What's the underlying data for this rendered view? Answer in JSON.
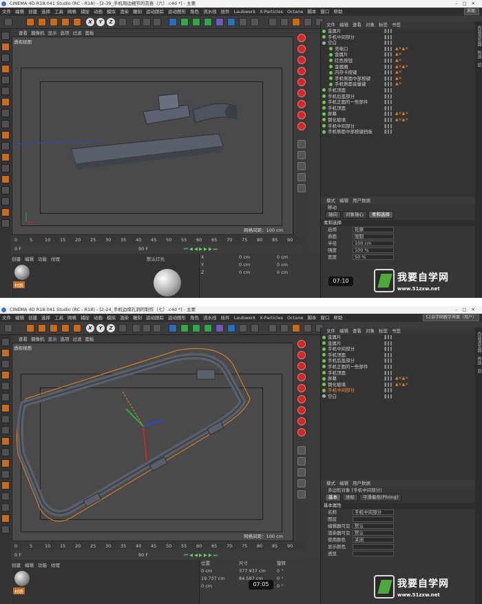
{
  "s1": {
    "title": "CINEMA 4D R18.041 Studio (RC - R18) - [2-39_手机周边细节的完善（六）.c4d *] - 主要",
    "menu": [
      "文件",
      "编辑",
      "创建",
      "选择",
      "工具",
      "网格",
      "捕捉",
      "动画",
      "模拟",
      "渲染",
      "雕刻",
      "运动跟踪",
      "运动图形",
      "角色",
      "流水线",
      "插件",
      "Laubwerk",
      "X-Particles",
      "Octane",
      "脚本",
      "窗口",
      "帮助"
    ],
    "layout": "界面:",
    "vpmenu": [
      "查看",
      "摄像机",
      "显示",
      "选项",
      "过滤",
      "面板"
    ],
    "vptitle": "透视视图",
    "grid": "网格间距：100 cm",
    "objmenu": [
      "文件",
      "编辑",
      "查看",
      "对象",
      "标签",
      "书签"
    ],
    "objects": [
      "金属片",
      "手机中间部分",
      "空白",
      "充电口",
      "金属片",
      "红色按钮",
      "金属圈",
      "内存卡按键",
      "手机侧面中部按键",
      "手机侧面音量键",
      "手机顶面",
      "手机后盖部分",
      "手机正面的一些部件",
      "手机顶面",
      "屏幕",
      "钢化玻璃",
      "手机中间部分",
      "手机侧面中部按键挡板"
    ],
    "attrmenu": [
      "模式",
      "编辑",
      "用户数据"
    ],
    "attrobj": "移动",
    "tabs": [
      "轴向",
      "对象轴心",
      "柔和选择"
    ],
    "sec": "柔和选择",
    "props": [
      [
        "启用",
        "轮廓"
      ],
      [
        "表面",
        "限制"
      ],
      [
        "半径",
        "100 cm"
      ],
      [
        "强度",
        "100 %"
      ],
      [
        "宽度",
        "50 %"
      ]
    ],
    "ticks": [
      "0",
      "5",
      "10",
      "15",
      "20",
      "25",
      "30",
      "35",
      "40",
      "45",
      "50",
      "55",
      "60",
      "65",
      "70",
      "75",
      "80",
      "85",
      "90"
    ],
    "frame": "0 F",
    "endframe": "90 F",
    "matmenu": [
      "创建",
      "编辑",
      "功能",
      "纹理"
    ],
    "matlabel": "材质",
    "light": "默认灯光",
    "coords": [
      [
        "X",
        "0 cm",
        "X",
        "0 cm",
        "H",
        "0 °"
      ],
      [
        "Y",
        "0 cm",
        "Y",
        "0 cm",
        "P",
        "0 °"
      ],
      [
        "Z",
        "0 cm",
        "Z",
        "0 cm",
        "B",
        "0 °"
      ]
    ],
    "time": "07:10"
  },
  "s2": {
    "title": "CINEMA 4D R18.041 Studio (RC - R18) - [2-24_手机边缘孔洞的制作（七）.c4d *] - 主要",
    "layout": "51自学网教学界面（用户）",
    "objects": [
      "金属片",
      "金属片",
      "手机中间部分",
      "手机顶面",
      "手机后盖部分",
      "手机正面的一些部件",
      "手机顶面",
      "屏幕",
      "钢化玻璃",
      "手机中间部分",
      "空白"
    ],
    "attrobj": "多边形对象 [手机中间部分]",
    "tabs": [
      "基本",
      "坐标",
      "平滑着色(Phong)"
    ],
    "sec": "基本属性",
    "props": [
      [
        "名称",
        "手机中间部分"
      ],
      [
        "图层",
        ""
      ],
      [
        "编辑器可见",
        "默认"
      ],
      [
        "渲染器可见",
        "默认"
      ],
      [
        "使用颜色",
        "关闭"
      ],
      [
        "显示颜色",
        ""
      ],
      [
        "透显",
        ""
      ]
    ],
    "coordhead": [
      "位置",
      "尺寸",
      "旋转"
    ],
    "coords": [
      [
        "X",
        "0 cm",
        "X",
        "377.937 cm",
        "H",
        "0 °"
      ],
      [
        "Y",
        "19.737 cm",
        "Y",
        "84.587 cm",
        "P",
        "0 °"
      ],
      [
        "Z",
        "0 cm",
        "Z",
        "",
        "B",
        "0 °"
      ]
    ],
    "time": "07:05"
  },
  "logo": {
    "cn": "我要自学网",
    "url": "www.51zxw.net"
  }
}
